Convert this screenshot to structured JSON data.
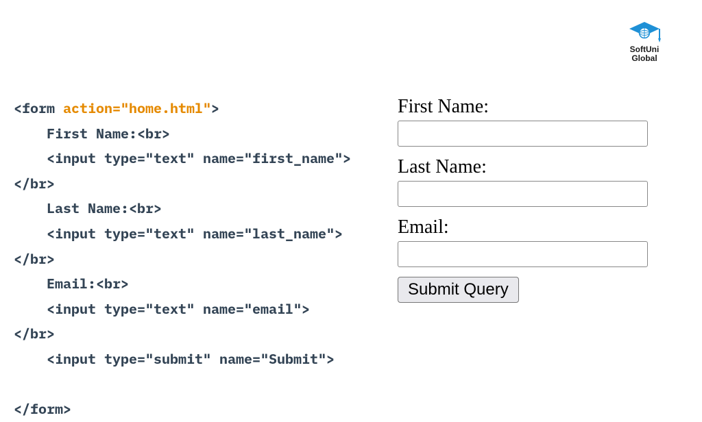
{
  "logo": {
    "line1": "SoftUni",
    "line2": "Global"
  },
  "code": {
    "open_form_left": "<form ",
    "form_attr": "action=\"home.html\"",
    "open_form_right": ">",
    "line_first_label": "    First Name:<br>",
    "line_first_input": "    <input type=\"text\" name=\"first_name\">",
    "close_br": "</br>",
    "line_last_label": "    Last Name:<br>",
    "line_last_input": "    <input type=\"text\" name=\"last_name\">",
    "line_email_label": "    Email:<br>",
    "line_email_input": "    <input type=\"text\" name=\"email\">",
    "line_submit": "    <input type=\"submit\" name=\"Submit\">",
    "close_form": "</form>"
  },
  "form": {
    "first_label": "First Name:",
    "last_label": "Last Name:",
    "email_label": "Email:",
    "submit_label": "Submit Query",
    "first_value": "",
    "last_value": "",
    "email_value": ""
  }
}
